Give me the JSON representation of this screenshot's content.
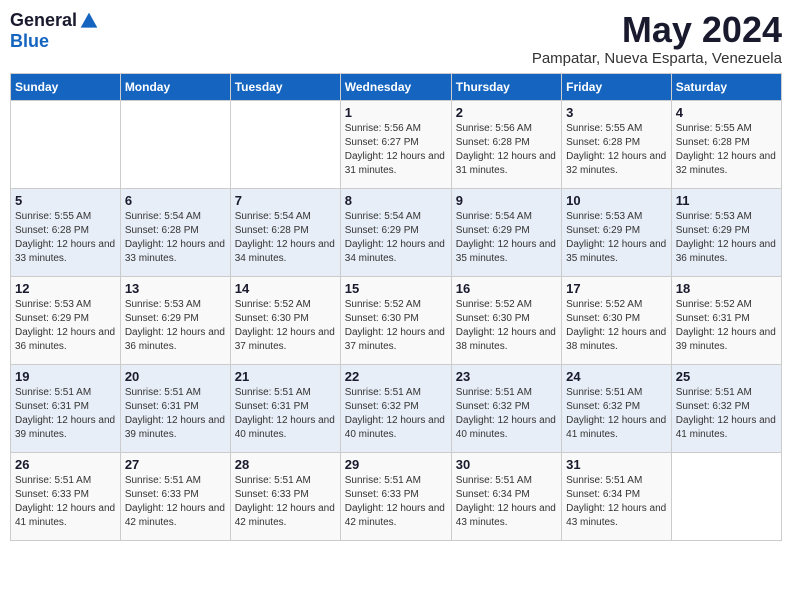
{
  "logo": {
    "general": "General",
    "blue": "Blue"
  },
  "title": "May 2024",
  "location": "Pampatar, Nueva Esparta, Venezuela",
  "days_of_week": [
    "Sunday",
    "Monday",
    "Tuesday",
    "Wednesday",
    "Thursday",
    "Friday",
    "Saturday"
  ],
  "weeks": [
    [
      {
        "day": "",
        "sunrise": "",
        "sunset": "",
        "daylight": ""
      },
      {
        "day": "",
        "sunrise": "",
        "sunset": "",
        "daylight": ""
      },
      {
        "day": "",
        "sunrise": "",
        "sunset": "",
        "daylight": ""
      },
      {
        "day": "1",
        "sunrise": "Sunrise: 5:56 AM",
        "sunset": "Sunset: 6:27 PM",
        "daylight": "Daylight: 12 hours and 31 minutes."
      },
      {
        "day": "2",
        "sunrise": "Sunrise: 5:56 AM",
        "sunset": "Sunset: 6:28 PM",
        "daylight": "Daylight: 12 hours and 31 minutes."
      },
      {
        "day": "3",
        "sunrise": "Sunrise: 5:55 AM",
        "sunset": "Sunset: 6:28 PM",
        "daylight": "Daylight: 12 hours and 32 minutes."
      },
      {
        "day": "4",
        "sunrise": "Sunrise: 5:55 AM",
        "sunset": "Sunset: 6:28 PM",
        "daylight": "Daylight: 12 hours and 32 minutes."
      }
    ],
    [
      {
        "day": "5",
        "sunrise": "Sunrise: 5:55 AM",
        "sunset": "Sunset: 6:28 PM",
        "daylight": "Daylight: 12 hours and 33 minutes."
      },
      {
        "day": "6",
        "sunrise": "Sunrise: 5:54 AM",
        "sunset": "Sunset: 6:28 PM",
        "daylight": "Daylight: 12 hours and 33 minutes."
      },
      {
        "day": "7",
        "sunrise": "Sunrise: 5:54 AM",
        "sunset": "Sunset: 6:28 PM",
        "daylight": "Daylight: 12 hours and 34 minutes."
      },
      {
        "day": "8",
        "sunrise": "Sunrise: 5:54 AM",
        "sunset": "Sunset: 6:29 PM",
        "daylight": "Daylight: 12 hours and 34 minutes."
      },
      {
        "day": "9",
        "sunrise": "Sunrise: 5:54 AM",
        "sunset": "Sunset: 6:29 PM",
        "daylight": "Daylight: 12 hours and 35 minutes."
      },
      {
        "day": "10",
        "sunrise": "Sunrise: 5:53 AM",
        "sunset": "Sunset: 6:29 PM",
        "daylight": "Daylight: 12 hours and 35 minutes."
      },
      {
        "day": "11",
        "sunrise": "Sunrise: 5:53 AM",
        "sunset": "Sunset: 6:29 PM",
        "daylight": "Daylight: 12 hours and 36 minutes."
      }
    ],
    [
      {
        "day": "12",
        "sunrise": "Sunrise: 5:53 AM",
        "sunset": "Sunset: 6:29 PM",
        "daylight": "Daylight: 12 hours and 36 minutes."
      },
      {
        "day": "13",
        "sunrise": "Sunrise: 5:53 AM",
        "sunset": "Sunset: 6:29 PM",
        "daylight": "Daylight: 12 hours and 36 minutes."
      },
      {
        "day": "14",
        "sunrise": "Sunrise: 5:52 AM",
        "sunset": "Sunset: 6:30 PM",
        "daylight": "Daylight: 12 hours and 37 minutes."
      },
      {
        "day": "15",
        "sunrise": "Sunrise: 5:52 AM",
        "sunset": "Sunset: 6:30 PM",
        "daylight": "Daylight: 12 hours and 37 minutes."
      },
      {
        "day": "16",
        "sunrise": "Sunrise: 5:52 AM",
        "sunset": "Sunset: 6:30 PM",
        "daylight": "Daylight: 12 hours and 38 minutes."
      },
      {
        "day": "17",
        "sunrise": "Sunrise: 5:52 AM",
        "sunset": "Sunset: 6:30 PM",
        "daylight": "Daylight: 12 hours and 38 minutes."
      },
      {
        "day": "18",
        "sunrise": "Sunrise: 5:52 AM",
        "sunset": "Sunset: 6:31 PM",
        "daylight": "Daylight: 12 hours and 39 minutes."
      }
    ],
    [
      {
        "day": "19",
        "sunrise": "Sunrise: 5:51 AM",
        "sunset": "Sunset: 6:31 PM",
        "daylight": "Daylight: 12 hours and 39 minutes."
      },
      {
        "day": "20",
        "sunrise": "Sunrise: 5:51 AM",
        "sunset": "Sunset: 6:31 PM",
        "daylight": "Daylight: 12 hours and 39 minutes."
      },
      {
        "day": "21",
        "sunrise": "Sunrise: 5:51 AM",
        "sunset": "Sunset: 6:31 PM",
        "daylight": "Daylight: 12 hours and 40 minutes."
      },
      {
        "day": "22",
        "sunrise": "Sunrise: 5:51 AM",
        "sunset": "Sunset: 6:32 PM",
        "daylight": "Daylight: 12 hours and 40 minutes."
      },
      {
        "day": "23",
        "sunrise": "Sunrise: 5:51 AM",
        "sunset": "Sunset: 6:32 PM",
        "daylight": "Daylight: 12 hours and 40 minutes."
      },
      {
        "day": "24",
        "sunrise": "Sunrise: 5:51 AM",
        "sunset": "Sunset: 6:32 PM",
        "daylight": "Daylight: 12 hours and 41 minutes."
      },
      {
        "day": "25",
        "sunrise": "Sunrise: 5:51 AM",
        "sunset": "Sunset: 6:32 PM",
        "daylight": "Daylight: 12 hours and 41 minutes."
      }
    ],
    [
      {
        "day": "26",
        "sunrise": "Sunrise: 5:51 AM",
        "sunset": "Sunset: 6:33 PM",
        "daylight": "Daylight: 12 hours and 41 minutes."
      },
      {
        "day": "27",
        "sunrise": "Sunrise: 5:51 AM",
        "sunset": "Sunset: 6:33 PM",
        "daylight": "Daylight: 12 hours and 42 minutes."
      },
      {
        "day": "28",
        "sunrise": "Sunrise: 5:51 AM",
        "sunset": "Sunset: 6:33 PM",
        "daylight": "Daylight: 12 hours and 42 minutes."
      },
      {
        "day": "29",
        "sunrise": "Sunrise: 5:51 AM",
        "sunset": "Sunset: 6:33 PM",
        "daylight": "Daylight: 12 hours and 42 minutes."
      },
      {
        "day": "30",
        "sunrise": "Sunrise: 5:51 AM",
        "sunset": "Sunset: 6:34 PM",
        "daylight": "Daylight: 12 hours and 43 minutes."
      },
      {
        "day": "31",
        "sunrise": "Sunrise: 5:51 AM",
        "sunset": "Sunset: 6:34 PM",
        "daylight": "Daylight: 12 hours and 43 minutes."
      },
      {
        "day": "",
        "sunrise": "",
        "sunset": "",
        "daylight": ""
      }
    ]
  ]
}
